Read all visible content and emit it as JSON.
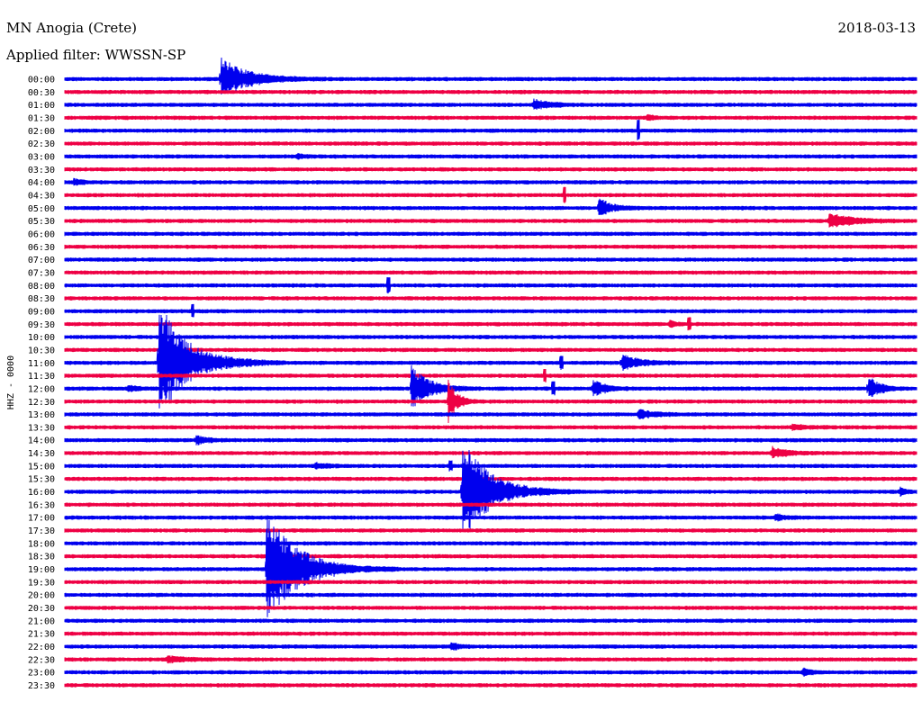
{
  "chart_data": {
    "type": "helicorder",
    "title": "MN Anogia (Crete)",
    "date": "2018-03-13",
    "filter_label": "Applied filter: WWSSN-SP",
    "channel_label": "HHZ - 0000",
    "row_labels": [
      "00:00",
      "00:30",
      "01:00",
      "01:30",
      "02:00",
      "02:30",
      "03:00",
      "03:30",
      "04:00",
      "04:30",
      "05:00",
      "05:30",
      "06:00",
      "06:30",
      "07:00",
      "07:30",
      "08:00",
      "08:30",
      "09:00",
      "09:30",
      "10:00",
      "10:30",
      "11:00",
      "11:30",
      "12:00",
      "12:30",
      "13:00",
      "13:30",
      "14:00",
      "14:30",
      "15:00",
      "15:30",
      "16:00",
      "16:30",
      "17:00",
      "17:30",
      "18:00",
      "18:30",
      "19:00",
      "19:30",
      "20:00",
      "20:30",
      "21:00",
      "21:30",
      "22:00",
      "22:30",
      "23:00",
      "23:30"
    ],
    "minutes_per_row": 30,
    "trace_colors": [
      "#0000ee",
      "#ee0044"
    ],
    "events": [
      {
        "row": 0,
        "minute": 5.5,
        "amp_rows": 1.4,
        "dur_min": 2.5
      },
      {
        "row": 2,
        "minute": 16.5,
        "amp_rows": 0.35,
        "dur_min": 1.5
      },
      {
        "row": 3,
        "minute": 20.5,
        "amp_rows": 0.2,
        "dur_min": 0.6
      },
      {
        "row": 6,
        "minute": 8.2,
        "amp_rows": 0.15,
        "dur_min": 0.6
      },
      {
        "row": 8,
        "minute": 0.3,
        "amp_rows": 0.2,
        "dur_min": 0.8
      },
      {
        "row": 10,
        "minute": 18.8,
        "amp_rows": 0.65,
        "dur_min": 1.2
      },
      {
        "row": 11,
        "minute": 26.9,
        "amp_rows": 0.55,
        "dur_min": 2.0
      },
      {
        "row": 19,
        "minute": 21.3,
        "amp_rows": 0.3,
        "dur_min": 0.4
      },
      {
        "row": 22,
        "minute": 3.3,
        "amp_rows": 4.0,
        "dur_min": 2.8
      },
      {
        "row": 22,
        "minute": 19.6,
        "amp_rows": 0.5,
        "dur_min": 1.7
      },
      {
        "row": 24,
        "minute": 2.2,
        "amp_rows": 0.2,
        "dur_min": 1.0
      },
      {
        "row": 24,
        "minute": 12.2,
        "amp_rows": 1.6,
        "dur_min": 1.6
      },
      {
        "row": 24,
        "minute": 18.6,
        "amp_rows": 0.6,
        "dur_min": 1.1
      },
      {
        "row": 24,
        "minute": 28.3,
        "amp_rows": 1.0,
        "dur_min": 0.9
      },
      {
        "row": 25,
        "minute": 13.5,
        "amp_rows": 1.5,
        "dur_min": 0.8
      },
      {
        "row": 26,
        "minute": 20.2,
        "amp_rows": 0.3,
        "dur_min": 1.5
      },
      {
        "row": 27,
        "minute": 25.6,
        "amp_rows": 0.2,
        "dur_min": 1.2
      },
      {
        "row": 28,
        "minute": 4.6,
        "amp_rows": 0.3,
        "dur_min": 1.0
      },
      {
        "row": 29,
        "minute": 24.9,
        "amp_rows": 0.4,
        "dur_min": 1.2
      },
      {
        "row": 30,
        "minute": 8.8,
        "amp_rows": 0.2,
        "dur_min": 1.0
      },
      {
        "row": 32,
        "minute": 14.0,
        "amp_rows": 3.6,
        "dur_min": 2.6
      },
      {
        "row": 32,
        "minute": 29.4,
        "amp_rows": 0.3,
        "dur_min": 0.5
      },
      {
        "row": 34,
        "minute": 25.0,
        "amp_rows": 0.2,
        "dur_min": 1.0
      },
      {
        "row": 38,
        "minute": 7.1,
        "amp_rows": 4.0,
        "dur_min": 2.9
      },
      {
        "row": 44,
        "minute": 13.6,
        "amp_rows": 0.3,
        "dur_min": 0.6
      },
      {
        "row": 45,
        "minute": 3.6,
        "amp_rows": 0.2,
        "dur_min": 1.5
      },
      {
        "row": 46,
        "minute": 26.0,
        "amp_rows": 0.3,
        "dur_min": 0.6
      }
    ],
    "spikes": [
      {
        "row": 4,
        "minute": 20.2,
        "amp_rows": 0.7
      },
      {
        "row": 9,
        "minute": 17.6,
        "amp_rows": 0.5
      },
      {
        "row": 16,
        "minute": 11.4,
        "amp_rows": 0.5
      },
      {
        "row": 18,
        "minute": 4.5,
        "amp_rows": 0.4
      },
      {
        "row": 19,
        "minute": 22.0,
        "amp_rows": 0.4
      },
      {
        "row": 22,
        "minute": 17.5,
        "amp_rows": 0.4
      },
      {
        "row": 23,
        "minute": 16.9,
        "amp_rows": 0.4
      },
      {
        "row": 24,
        "minute": 17.2,
        "amp_rows": 0.4
      },
      {
        "row": 30,
        "minute": 13.6,
        "amp_rows": 0.3
      }
    ]
  }
}
